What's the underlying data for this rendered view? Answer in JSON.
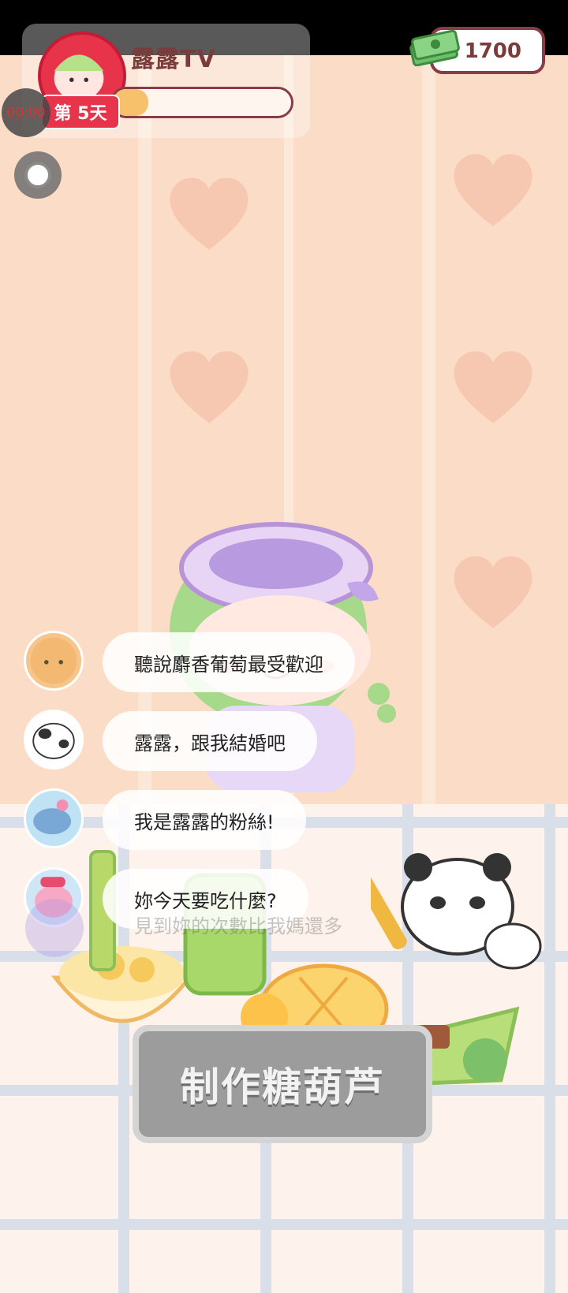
{
  "streamer": {
    "name": "露露TV",
    "day_label": "第 5天",
    "progress": 0.2
  },
  "timer": "00:00",
  "money": {
    "value": "1700"
  },
  "chat": [
    {
      "text": "聽說麝香葡萄最受歡迎"
    },
    {
      "text": "露露，跟我結婚吧"
    },
    {
      "text": "我是露露的粉絲!"
    },
    {
      "text": "妳今天要吃什麼?"
    }
  ],
  "ghost_message": "見到妳的次數比我媽還多",
  "action_button": "制作糖葫芦",
  "colors": {
    "accent_red": "#e8344b",
    "brown_text": "#7a3b3b",
    "progress_fill": "#f7c06a",
    "button_gray": "#9c9c9c"
  }
}
